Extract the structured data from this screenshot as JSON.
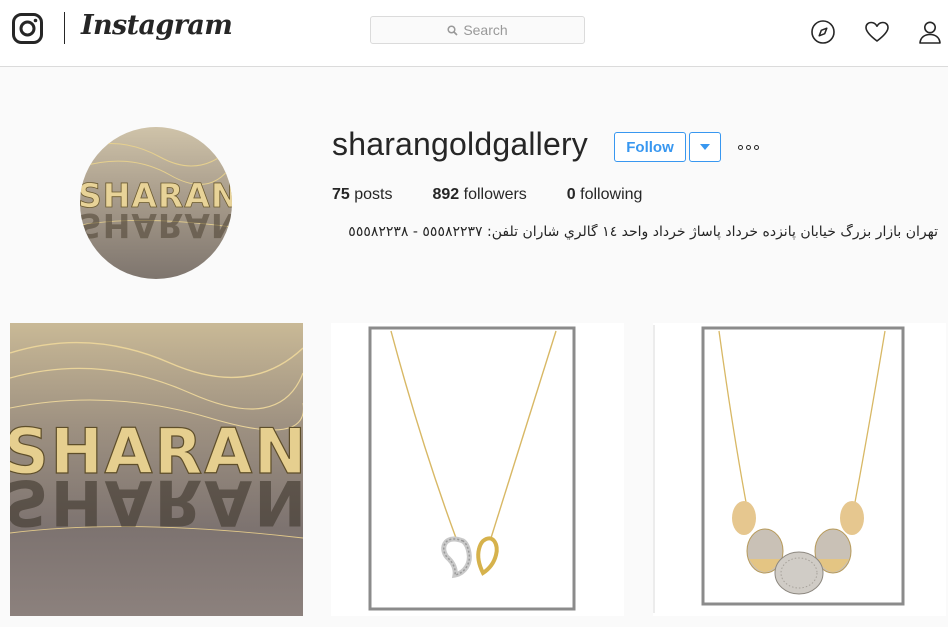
{
  "header": {
    "brand": "Instagram",
    "search": {
      "placeholder": "Search"
    },
    "icons": [
      "compass-icon",
      "heart-icon",
      "person-icon"
    ]
  },
  "profile": {
    "username": "sharangoldgallery",
    "follow_label": "Follow",
    "stats": [
      {
        "count": "75",
        "label": "posts"
      },
      {
        "count": "892",
        "label": "followers"
      },
      {
        "count": "0",
        "label": "following"
      }
    ],
    "bio": "تهران بازار بزرگ خيابان پانزده خرداد پاساژ خرداد واحد ١٤ گالري شاران تلفن: ٥٥٥٨٢٢٣٧ - ٥٥٥٨٢٢٣٨"
  },
  "avatar_text": "SHARAN",
  "posts": [
    {
      "kind": "letters-photo",
      "text": "SHARAN"
    },
    {
      "kind": "necklace-hearts"
    },
    {
      "kind": "necklace-stones"
    }
  ],
  "colors": {
    "accent": "#3897f0",
    "text": "#262626",
    "border": "#dbdbdb",
    "background": "#fafafa",
    "gold": "#d8b865"
  }
}
